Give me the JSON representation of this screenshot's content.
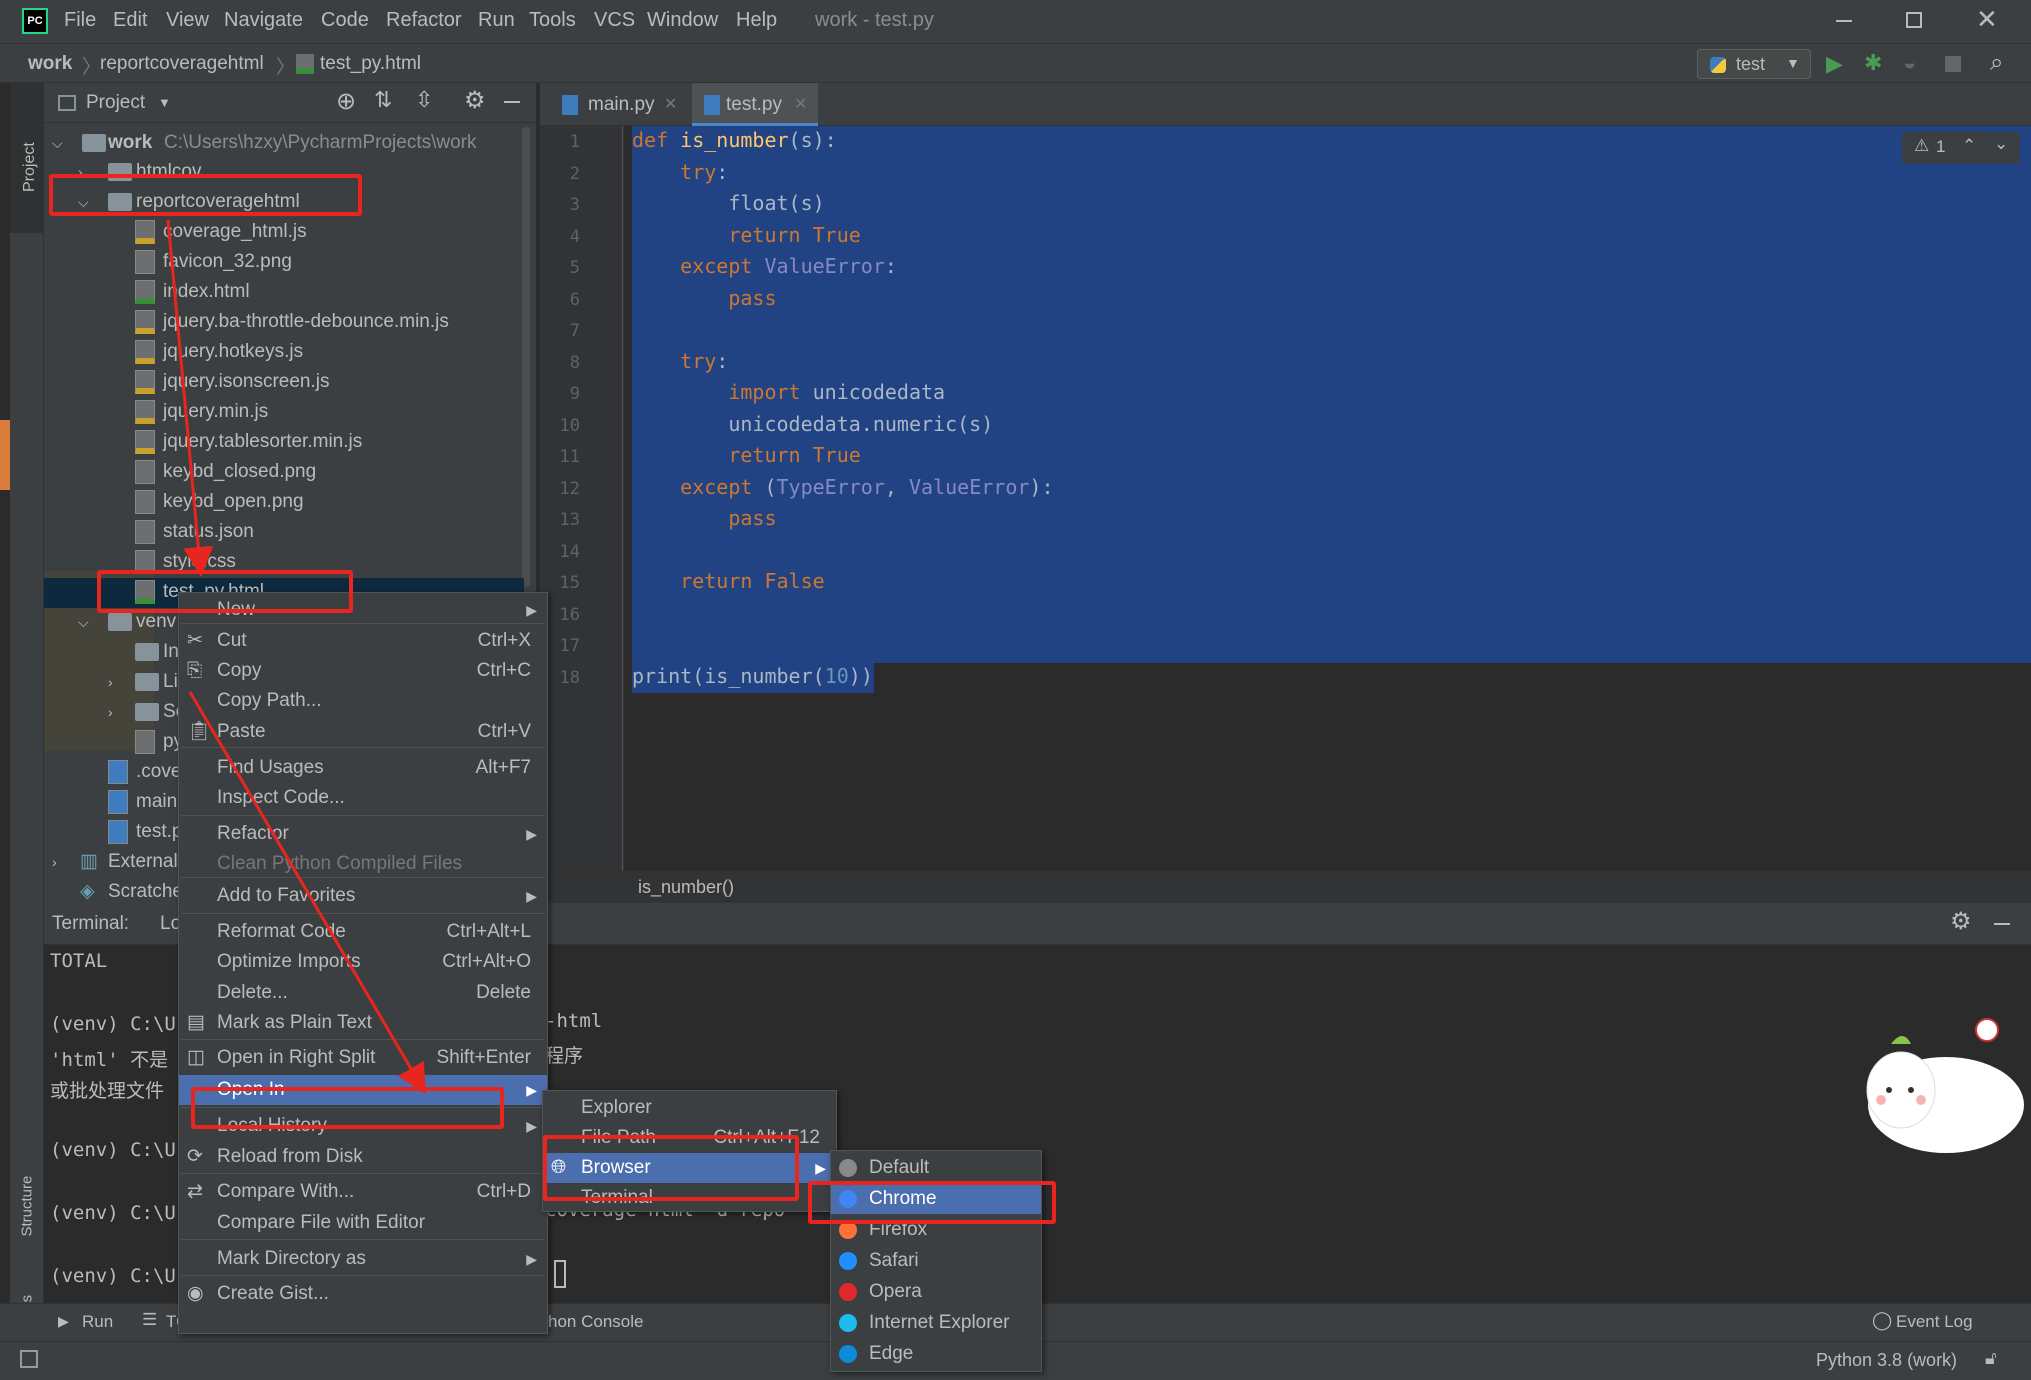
{
  "menubar": {
    "logo": "PC",
    "items": [
      "File",
      "Edit",
      "View",
      "Navigate",
      "Code",
      "Refactor",
      "Run",
      "Tools",
      "VCS",
      "Window",
      "Help"
    ],
    "window_title": "work - test.py"
  },
  "navbar": {
    "crumbs": [
      "work",
      "reportcoveragehtml",
      "test_py.html"
    ],
    "run_config": "test"
  },
  "left_strip": {
    "project": "Project",
    "structure": "Structure",
    "favorites": "Favorites"
  },
  "project_panel": {
    "title": "Project",
    "root_name": "work",
    "root_path": "C:\\Users\\hzxy\\PycharmProjects\\work",
    "tree": [
      "htmlcov",
      "reportcoveragehtml",
      "coverage_html.js",
      "favicon_32.png",
      "index.html",
      "jquery.ba-throttle-debounce.min.js",
      "jquery.hotkeys.js",
      "jquery.isonscreen.js",
      "jquery.min.js",
      "jquery.tablesorter.min.js",
      "keybd_closed.png",
      "keybd_open.png",
      "status.json",
      "style.css",
      "test_py.html",
      "venv",
      "In",
      "Li",
      "Sc",
      "py",
      ".cove",
      "main",
      "test.p",
      "External",
      "Scratche"
    ]
  },
  "editor": {
    "tabs": [
      "main.py",
      "test.py"
    ],
    "warning_count": "1",
    "lines": [
      "def is_number(s):",
      "    try:",
      "        float(s)",
      "        return True",
      "    except ValueError:",
      "        pass",
      "",
      "    try:",
      "        import unicodedata",
      "        unicodedata.numeric(s)",
      "        return True",
      "    except (TypeError, ValueError):",
      "        pass",
      "",
      "    return False",
      "",
      "",
      "print(is_number(10))"
    ],
    "breadcrumb": "is_number()"
  },
  "terminal": {
    "label": "Terminal:",
    "tab": "Lo",
    "lines": [
      "TOTAL",
      "",
      "(venv) C:\\U",
      "'html' 不是",
      "或批处理文件",
      "",
      "(venv) C:\\U",
      "",
      "(venv) C:\\U",
      "",
      "(venv) C:\\U"
    ],
    "right_fragments": [
      "-html",
      "程序",
      "coverage html -d repo"
    ]
  },
  "context_menu": {
    "items": [
      {
        "label": "New",
        "shortcut": "",
        "submenu": true
      },
      {
        "label": "Cut",
        "shortcut": "Ctrl+X",
        "submenu": false
      },
      {
        "label": "Copy",
        "shortcut": "Ctrl+C",
        "submenu": false
      },
      {
        "label": "Copy Path...",
        "shortcut": "",
        "submenu": false
      },
      {
        "label": "Paste",
        "shortcut": "Ctrl+V",
        "submenu": false
      },
      {
        "label": "Find Usages",
        "shortcut": "Alt+F7",
        "submenu": false
      },
      {
        "label": "Inspect Code...",
        "shortcut": "",
        "submenu": false
      },
      {
        "label": "Refactor",
        "shortcut": "",
        "submenu": true
      },
      {
        "label": "Clean Python Compiled Files",
        "shortcut": "",
        "submenu": false,
        "disabled": true
      },
      {
        "label": "Add to Favorites",
        "shortcut": "",
        "submenu": true
      },
      {
        "label": "Reformat Code",
        "shortcut": "Ctrl+Alt+L",
        "submenu": false
      },
      {
        "label": "Optimize Imports",
        "shortcut": "Ctrl+Alt+O",
        "submenu": false
      },
      {
        "label": "Delete...",
        "shortcut": "Delete",
        "submenu": false
      },
      {
        "label": "Mark as Plain Text",
        "shortcut": "",
        "submenu": false
      },
      {
        "label": "Open in Right Split",
        "shortcut": "Shift+Enter",
        "submenu": false
      },
      {
        "label": "Open In",
        "shortcut": "",
        "submenu": true
      },
      {
        "label": "Local History",
        "shortcut": "",
        "submenu": true
      },
      {
        "label": "Reload from Disk",
        "shortcut": "",
        "submenu": false
      },
      {
        "label": "Compare With...",
        "shortcut": "Ctrl+D",
        "submenu": false
      },
      {
        "label": "Compare File with Editor",
        "shortcut": "",
        "submenu": false
      },
      {
        "label": "Mark Directory as",
        "shortcut": "",
        "submenu": true
      },
      {
        "label": "Create Gist...",
        "shortcut": "",
        "submenu": false
      }
    ]
  },
  "open_in_menu": {
    "items": [
      {
        "label": "Explorer",
        "shortcut": ""
      },
      {
        "label": "File Path",
        "shortcut": "Ctrl+Alt+F12"
      },
      {
        "label": "Browser",
        "shortcut": ""
      },
      {
        "label": "Terminal",
        "shortcut": ""
      }
    ]
  },
  "browser_menu": {
    "items": [
      "Default",
      "Chrome",
      "Firefox",
      "Safari",
      "Opera",
      "Internet Explorer",
      "Edge"
    ]
  },
  "bottom_tools": {
    "run": "Run",
    "todo": "TO",
    "python_console": "hon Console",
    "event_log": "Event Log"
  },
  "status_bar": {
    "interpreter": "Python 3.8 (work)"
  },
  "colors": {
    "highlight": "#4b6eaf",
    "selection": "#214283",
    "annotation": "#e8261f",
    "keyword": "#cc7832"
  }
}
